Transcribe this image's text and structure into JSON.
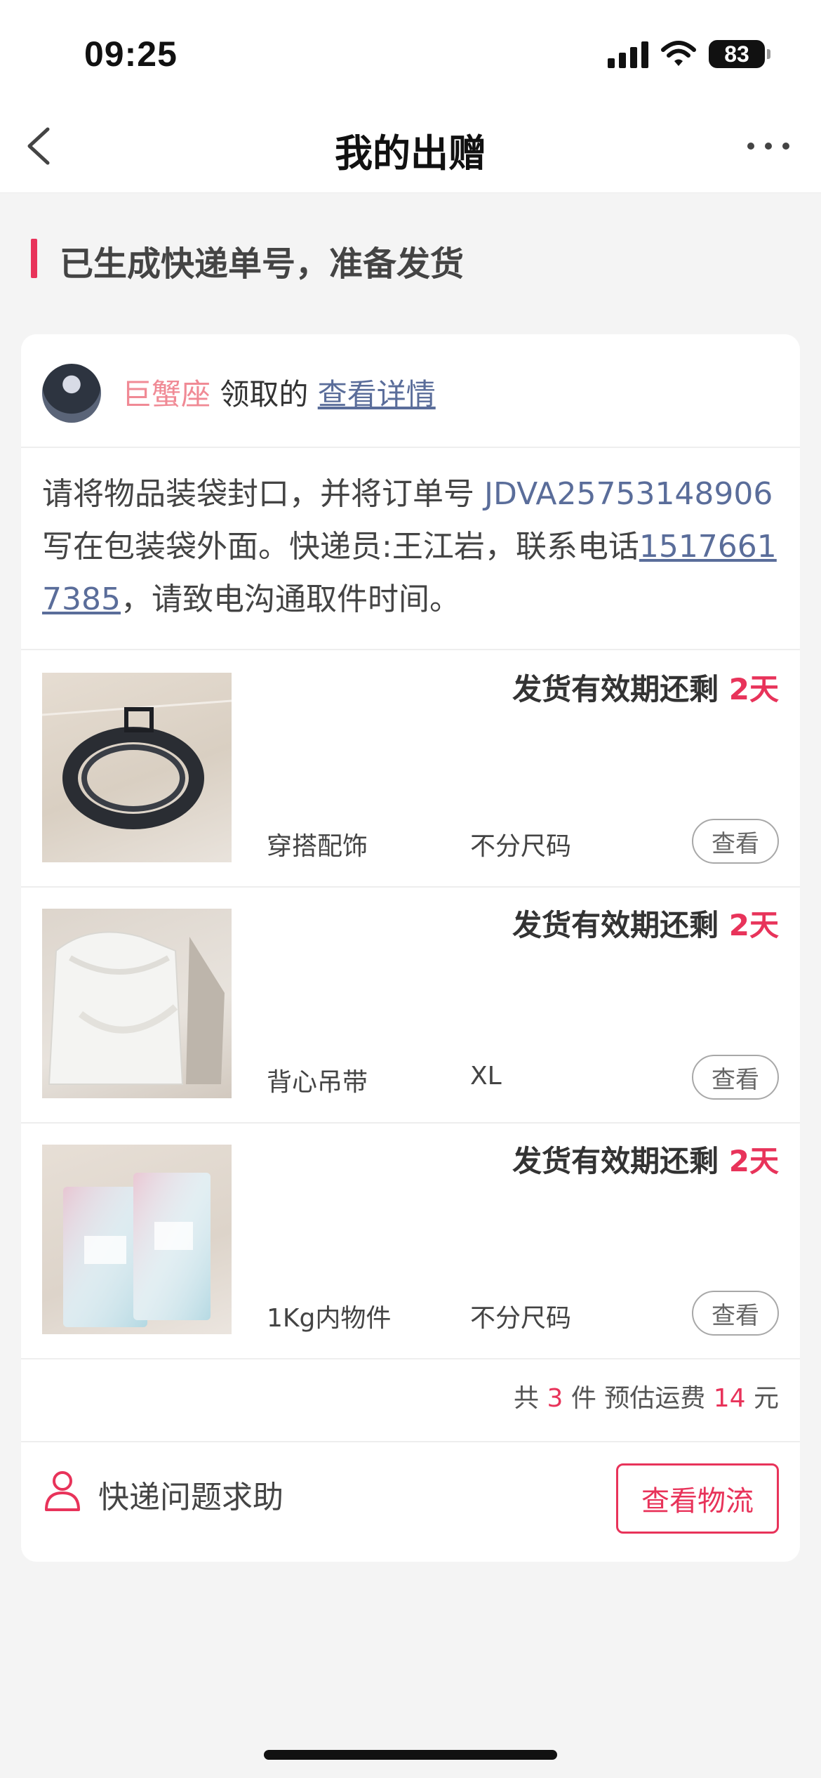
{
  "status_bar": {
    "time": "09:25",
    "battery": "83"
  },
  "nav": {
    "title": "我的出赠",
    "back_icon": "chevron-left-icon",
    "more_icon": "more-horizontal-icon"
  },
  "section": {
    "title": "已生成快递单号，准备发货"
  },
  "card": {
    "receiver_name": "巨蟹座",
    "received_text": " 领取的 ",
    "detail_link": "查看详情",
    "instruction_part1": "请将物品装袋封口，并将订单号 ",
    "order_number": "JDVA25753148906",
    "instruction_part2": " 写在包装袋外面。快递员:王江岩，联系电话",
    "phone": "15176617385",
    "instruction_part3": "，请致电沟通取件时间。",
    "items": [
      {
        "deadline_label": "发货有效期还剩 ",
        "deadline_days": "2天",
        "category": "穿搭配饰",
        "size": "不分尺码",
        "view_label": "查看"
      },
      {
        "deadline_label": "发货有效期还剩 ",
        "deadline_days": "2天",
        "category": "背心吊带",
        "size": "XL",
        "view_label": "查看"
      },
      {
        "deadline_label": "发货有效期还剩 ",
        "deadline_days": "2天",
        "category": "1Kg内物件",
        "size": "不分尺码",
        "view_label": "查看"
      }
    ],
    "summary": {
      "prefix": "共 ",
      "count": "3",
      "middle": " 件 预估运费 ",
      "fee": "14",
      "suffix": " 元"
    },
    "help_text": "快递问题求助",
    "logistics_button": "查看物流"
  },
  "colors": {
    "accent": "#e8335a",
    "link": "#5a6d9a",
    "receiver": "#f08a95",
    "background": "#f4f4f4"
  }
}
